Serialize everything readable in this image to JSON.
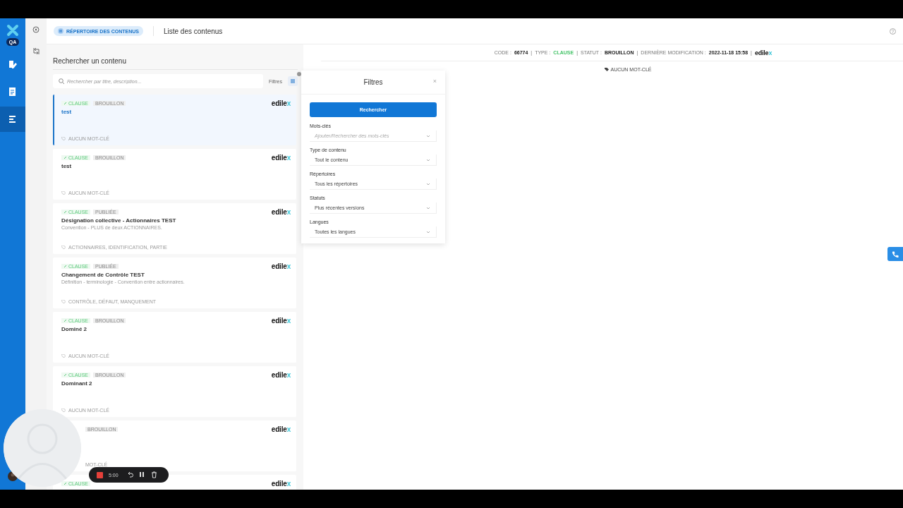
{
  "rail": {
    "badge": "QA",
    "items": [
      {
        "kind": "edit",
        "selected": false
      },
      {
        "kind": "document",
        "selected": false
      },
      {
        "kind": "list",
        "selected": true
      }
    ]
  },
  "header": {
    "breadcrumb": "RÉPERTOIRE DES CONTENUS",
    "title": "Liste des contenus"
  },
  "search_panel": {
    "heading": "Rechercher un contenu",
    "search": {
      "placeholder": "Rechercher par titre, description..."
    },
    "filters_label": "Filtres"
  },
  "cards": [
    {
      "type": "CLAUSE",
      "status": "BROUILLON",
      "title": "test",
      "keywords": "AUCUN MOT-CLÉ",
      "brand": "edile",
      "brand_mark": "x",
      "selected": true
    },
    {
      "type": "CLAUSE",
      "status": "BROUILLON",
      "title": "test",
      "keywords": "AUCUN MOT-CLÉ",
      "brand": "edile",
      "brand_mark": "x",
      "selected": false
    },
    {
      "type": "CLAUSE",
      "status": "PUBLIÉE",
      "title": "Désignation collective - Actionnaires TEST",
      "description": "Convention - PLUS de deux ACTIONNAIRES.",
      "keywords": "ACTIONNAIRES, IDENTIFICATION, PARTIE",
      "brand": "edile",
      "brand_mark": "x",
      "selected": false
    },
    {
      "type": "CLAUSE",
      "status": "PUBLIÉE",
      "title": "Changement de Contrôle TEST",
      "description": "Définition - terminologie - Convention entre actionnaires.",
      "keywords": "CONTRÔLE, DÉFAUT, MANQUEMENT",
      "brand": "edile",
      "brand_mark": "x",
      "selected": false
    },
    {
      "type": "CLAUSE",
      "status": "BROUILLON",
      "title": "Dominé 2",
      "keywords": "AUCUN MOT-CLÉ",
      "brand": "edile",
      "brand_mark": "x",
      "selected": false
    },
    {
      "type": "CLAUSE",
      "status": "BROUILLON",
      "title": "Dominant 2",
      "keywords": "AUCUN MOT-CLÉ",
      "brand": "edile",
      "brand_mark": "x",
      "selected": false
    },
    {
      "status": "BROUILLON",
      "keywords": "MOT-CLÉ",
      "brand": "edile",
      "brand_mark": "x",
      "selected": false,
      "partly_hidden": true
    },
    {
      "type": "CLAUSE",
      "brand": "edile",
      "brand_mark": "x",
      "selected": false
    }
  ],
  "meta": {
    "items": [
      {
        "label": "CODE :",
        "value": "66774",
        "kind": "bold"
      },
      {
        "label": "TYPE :",
        "value": "CLAUSE",
        "kind": "green"
      },
      {
        "label": "STATUT :",
        "value": "BROUILLON",
        "kind": "bold"
      },
      {
        "label": "DERNIÈRE MODIFICATION :",
        "value": "2022-11-18 15:58",
        "kind": "bold"
      }
    ],
    "separator": "|",
    "brand": "edile",
    "brand_mark": "x",
    "keywords": "AUCUN MOT-CLÉ"
  },
  "filters": {
    "title": "Filtres",
    "close": "×",
    "button": "Rechercher",
    "fields": [
      {
        "label": "Mots-clés",
        "placeholder": "Ajouter/Rechercher des mots-clés"
      },
      {
        "label": "Type de contenu",
        "value": "Tout le contenu"
      },
      {
        "label": "Répertoires",
        "value": "Tous les répertoires"
      },
      {
        "label": "Statuts",
        "value": "Plus récentes versions"
      },
      {
        "label": "Langues",
        "value": "Toutes les langues"
      }
    ]
  },
  "recorder": {
    "time": "5:00"
  }
}
